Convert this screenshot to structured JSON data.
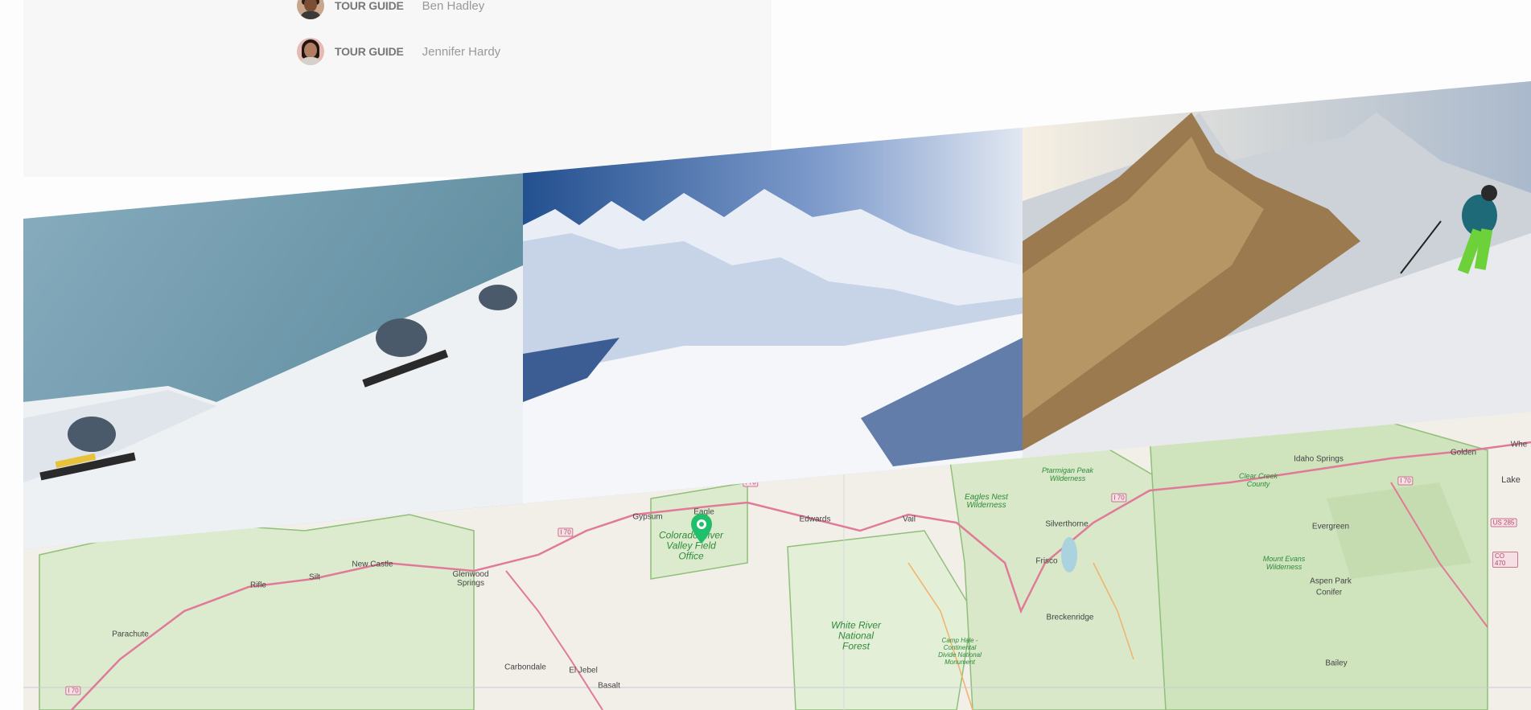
{
  "guides": [
    {
      "role": "Tour guide",
      "name": "Ben Hadley",
      "avatar": "man-avatar"
    },
    {
      "role": "Tour guide",
      "name": "Jennifer Hardy",
      "avatar": "woman-avatar"
    }
  ],
  "pictures": [
    {
      "name": "tour-picture-snowboarders"
    },
    {
      "name": "tour-picture-mountain-valley"
    },
    {
      "name": "tour-picture-skier"
    }
  ],
  "map": {
    "places": [
      "Idaho Springs",
      "Golden",
      "Lake",
      "Edwards",
      "Vail",
      "Silverthorne",
      "Frisco",
      "Breckenridge",
      "Evergreen",
      "Conifer",
      "Aspen Park",
      "Bailey",
      "Gypsum",
      "Eagle",
      "New Castle",
      "Rifle",
      "Silt",
      "Parachute",
      "Glenwood Springs",
      "Carbondale",
      "El Jebel",
      "Basalt",
      "Whe"
    ],
    "areas": [
      "Colorado River Valley Field Office",
      "White River National Forest",
      "Eagles Nest Wilderness",
      "Mount Evans Wilderness",
      "Ptarmigan Peak Wilderness",
      "Clear Creek County",
      "Camp Hale - Continental Divide National Monument"
    ],
    "roads": [
      "I 70",
      "US 285",
      "CO 470"
    ],
    "marker_icon": "location-pin-icon",
    "colors": {
      "forest": "#cfe3bd",
      "forest_border": "#8fbf7a",
      "highway": "#e07a98",
      "land": "#f2efe9",
      "marker": "#20bf6b"
    }
  }
}
